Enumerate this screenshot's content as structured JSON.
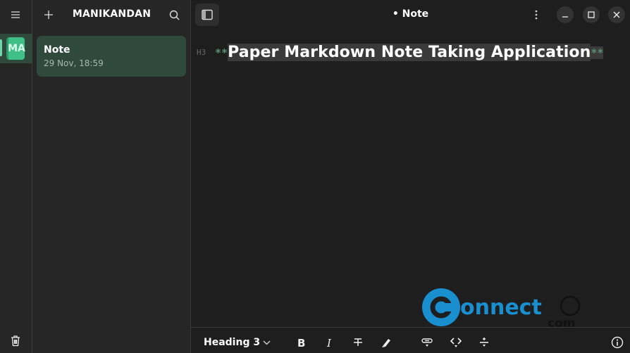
{
  "rail": {
    "menu_icon": "hamburger-menu-icon",
    "notebook_initials": "MA",
    "trash_icon": "trash-icon"
  },
  "list": {
    "title": "MANIKANDAN",
    "add_icon": "plus-icon",
    "search_icon": "search-icon",
    "notes": [
      {
        "title": "Note",
        "date": "29 Nov, 18:59"
      }
    ]
  },
  "window": {
    "title": "• Note",
    "sidebar_toggle_icon": "sidebar-icon",
    "menu_icon": "kebab-icon",
    "minimize_icon": "minimize-icon",
    "maximize_icon": "maximize-icon",
    "close_icon": "close-icon"
  },
  "editor": {
    "heading_level_label": "H3",
    "open_marker": "**",
    "heading_text": "Paper Markdown Note Taking Application",
    "close_marker": "**"
  },
  "toolbar": {
    "heading_select": "Heading 3",
    "buttons": [
      "bold",
      "italic",
      "strikethrough",
      "highlight",
      "link",
      "code",
      "horizontal-rule"
    ],
    "info_icon": "info-icon"
  },
  "watermark": {
    "text": "onnect",
    "sub": "com",
    "color": "#1a8fd0"
  },
  "colors": {
    "accent": "#3ec087",
    "selected_bg": "#2f4a3d",
    "markdown_marker": "#5a8f75"
  }
}
